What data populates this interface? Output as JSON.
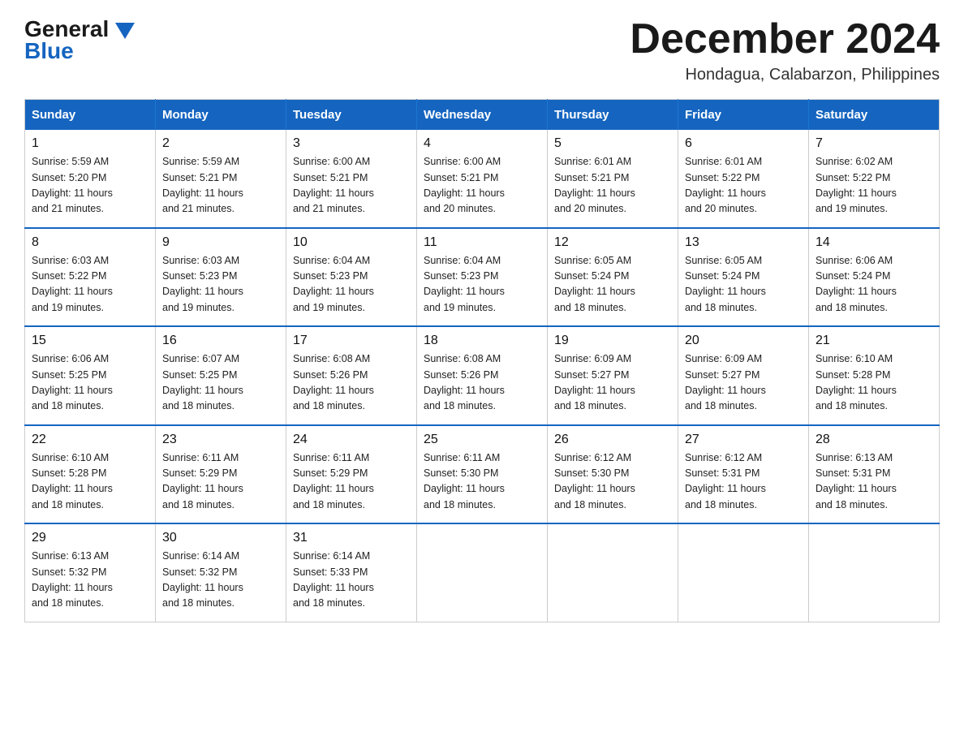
{
  "logo": {
    "general": "General",
    "blue": "Blue"
  },
  "header": {
    "month": "December 2024",
    "location": "Hondagua, Calabarzon, Philippines"
  },
  "weekdays": [
    "Sunday",
    "Monday",
    "Tuesday",
    "Wednesday",
    "Thursday",
    "Friday",
    "Saturday"
  ],
  "weeks": [
    [
      {
        "day": "1",
        "sunrise": "5:59 AM",
        "sunset": "5:20 PM",
        "daylight": "11 hours and 21 minutes."
      },
      {
        "day": "2",
        "sunrise": "5:59 AM",
        "sunset": "5:21 PM",
        "daylight": "11 hours and 21 minutes."
      },
      {
        "day": "3",
        "sunrise": "6:00 AM",
        "sunset": "5:21 PM",
        "daylight": "11 hours and 21 minutes."
      },
      {
        "day": "4",
        "sunrise": "6:00 AM",
        "sunset": "5:21 PM",
        "daylight": "11 hours and 20 minutes."
      },
      {
        "day": "5",
        "sunrise": "6:01 AM",
        "sunset": "5:21 PM",
        "daylight": "11 hours and 20 minutes."
      },
      {
        "day": "6",
        "sunrise": "6:01 AM",
        "sunset": "5:22 PM",
        "daylight": "11 hours and 20 minutes."
      },
      {
        "day": "7",
        "sunrise": "6:02 AM",
        "sunset": "5:22 PM",
        "daylight": "11 hours and 19 minutes."
      }
    ],
    [
      {
        "day": "8",
        "sunrise": "6:03 AM",
        "sunset": "5:22 PM",
        "daylight": "11 hours and 19 minutes."
      },
      {
        "day": "9",
        "sunrise": "6:03 AM",
        "sunset": "5:23 PM",
        "daylight": "11 hours and 19 minutes."
      },
      {
        "day": "10",
        "sunrise": "6:04 AM",
        "sunset": "5:23 PM",
        "daylight": "11 hours and 19 minutes."
      },
      {
        "day": "11",
        "sunrise": "6:04 AM",
        "sunset": "5:23 PM",
        "daylight": "11 hours and 19 minutes."
      },
      {
        "day": "12",
        "sunrise": "6:05 AM",
        "sunset": "5:24 PM",
        "daylight": "11 hours and 18 minutes."
      },
      {
        "day": "13",
        "sunrise": "6:05 AM",
        "sunset": "5:24 PM",
        "daylight": "11 hours and 18 minutes."
      },
      {
        "day": "14",
        "sunrise": "6:06 AM",
        "sunset": "5:24 PM",
        "daylight": "11 hours and 18 minutes."
      }
    ],
    [
      {
        "day": "15",
        "sunrise": "6:06 AM",
        "sunset": "5:25 PM",
        "daylight": "11 hours and 18 minutes."
      },
      {
        "day": "16",
        "sunrise": "6:07 AM",
        "sunset": "5:25 PM",
        "daylight": "11 hours and 18 minutes."
      },
      {
        "day": "17",
        "sunrise": "6:08 AM",
        "sunset": "5:26 PM",
        "daylight": "11 hours and 18 minutes."
      },
      {
        "day": "18",
        "sunrise": "6:08 AM",
        "sunset": "5:26 PM",
        "daylight": "11 hours and 18 minutes."
      },
      {
        "day": "19",
        "sunrise": "6:09 AM",
        "sunset": "5:27 PM",
        "daylight": "11 hours and 18 minutes."
      },
      {
        "day": "20",
        "sunrise": "6:09 AM",
        "sunset": "5:27 PM",
        "daylight": "11 hours and 18 minutes."
      },
      {
        "day": "21",
        "sunrise": "6:10 AM",
        "sunset": "5:28 PM",
        "daylight": "11 hours and 18 minutes."
      }
    ],
    [
      {
        "day": "22",
        "sunrise": "6:10 AM",
        "sunset": "5:28 PM",
        "daylight": "11 hours and 18 minutes."
      },
      {
        "day": "23",
        "sunrise": "6:11 AM",
        "sunset": "5:29 PM",
        "daylight": "11 hours and 18 minutes."
      },
      {
        "day": "24",
        "sunrise": "6:11 AM",
        "sunset": "5:29 PM",
        "daylight": "11 hours and 18 minutes."
      },
      {
        "day": "25",
        "sunrise": "6:11 AM",
        "sunset": "5:30 PM",
        "daylight": "11 hours and 18 minutes."
      },
      {
        "day": "26",
        "sunrise": "6:12 AM",
        "sunset": "5:30 PM",
        "daylight": "11 hours and 18 minutes."
      },
      {
        "day": "27",
        "sunrise": "6:12 AM",
        "sunset": "5:31 PM",
        "daylight": "11 hours and 18 minutes."
      },
      {
        "day": "28",
        "sunrise": "6:13 AM",
        "sunset": "5:31 PM",
        "daylight": "11 hours and 18 minutes."
      }
    ],
    [
      {
        "day": "29",
        "sunrise": "6:13 AM",
        "sunset": "5:32 PM",
        "daylight": "11 hours and 18 minutes."
      },
      {
        "day": "30",
        "sunrise": "6:14 AM",
        "sunset": "5:32 PM",
        "daylight": "11 hours and 18 minutes."
      },
      {
        "day": "31",
        "sunrise": "6:14 AM",
        "sunset": "5:33 PM",
        "daylight": "11 hours and 18 minutes."
      },
      null,
      null,
      null,
      null
    ]
  ],
  "labels": {
    "sunrise": "Sunrise:",
    "sunset": "Sunset:",
    "daylight": "Daylight:"
  }
}
